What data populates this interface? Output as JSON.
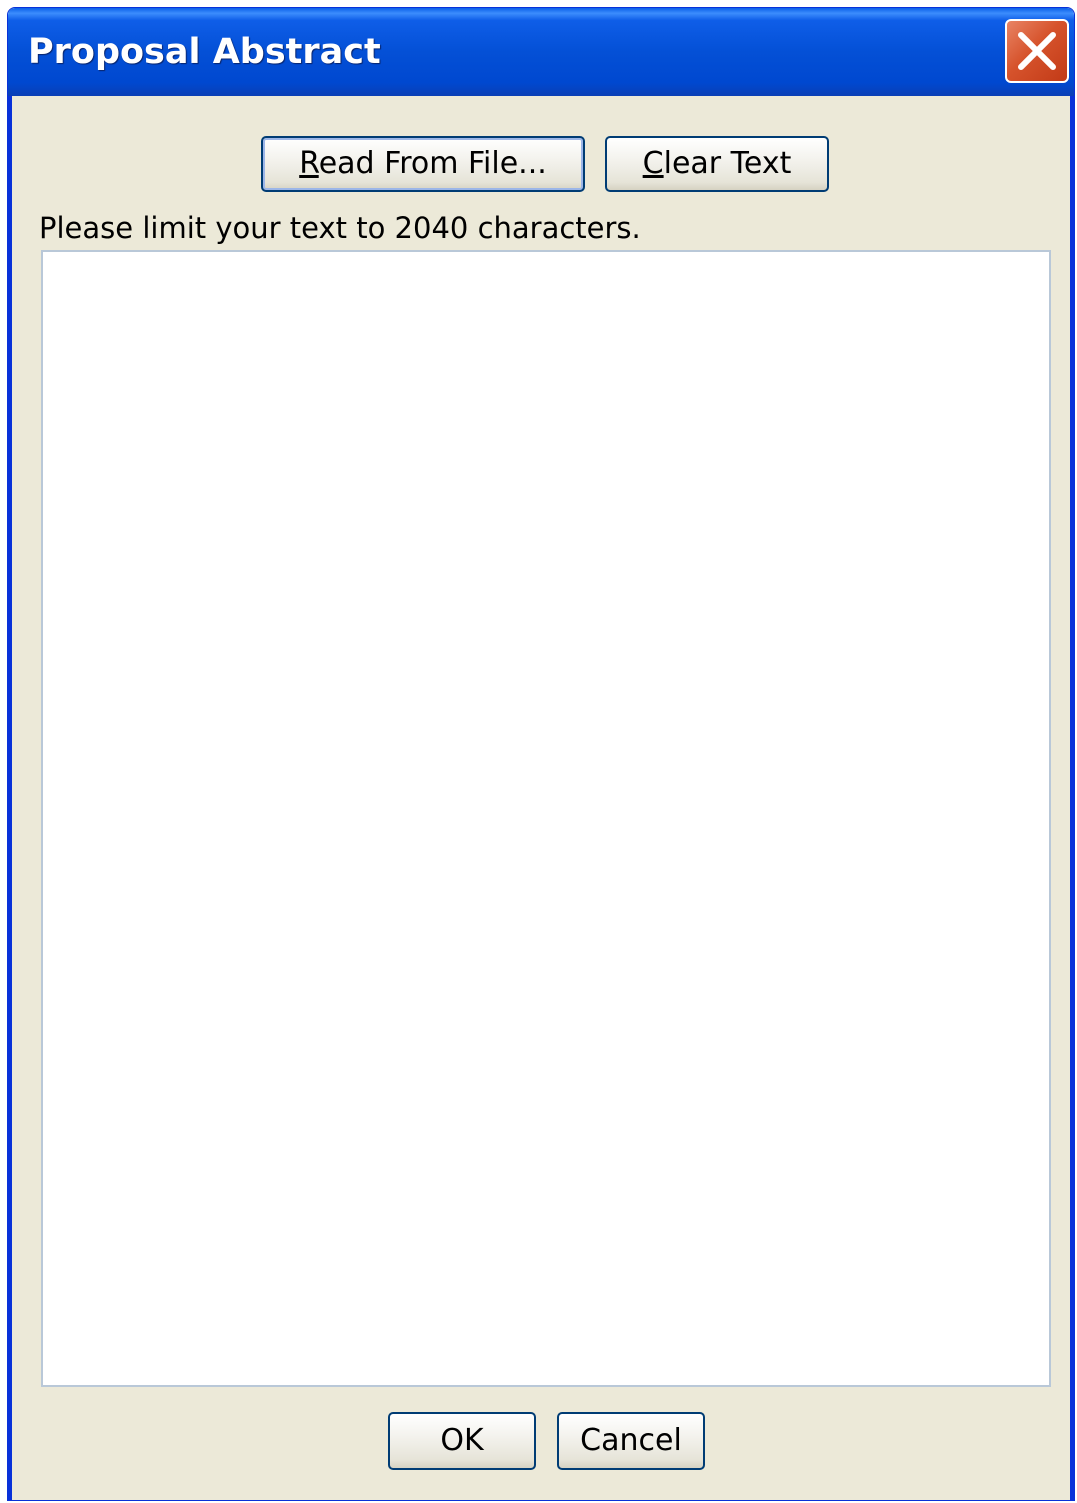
{
  "window": {
    "title": "Proposal Abstract",
    "close_icon": "close-x-icon",
    "colors": {
      "titlebar": "#0450d6",
      "body": "#ece9d8",
      "close_button": "#d6532c"
    }
  },
  "toolbar": {
    "read_from_file": {
      "mnemonic": "R",
      "rest": "ead From File..."
    },
    "clear_text": {
      "mnemonic": "C",
      "rest": "lear Text"
    }
  },
  "editor": {
    "hint": "Please limit your text to 2040 characters.",
    "value": ""
  },
  "footer": {
    "ok_label": "OK",
    "cancel_label": "Cancel"
  }
}
